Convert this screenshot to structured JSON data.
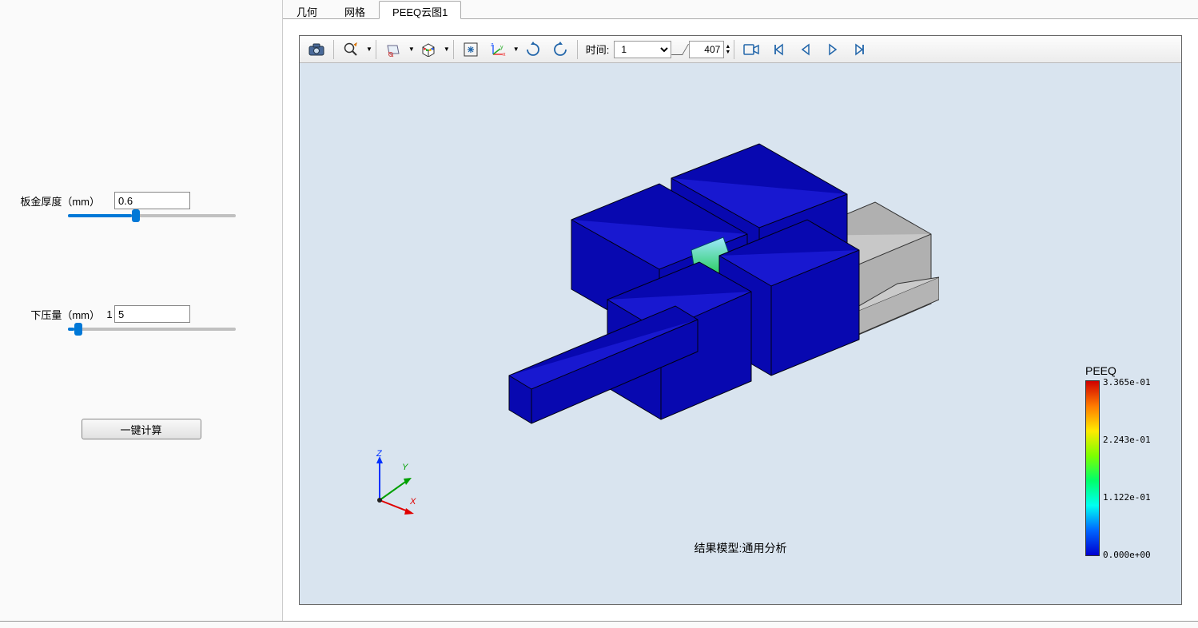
{
  "left": {
    "thickness_label": "板金厚度（mm）",
    "thickness_value": "0.6",
    "press_label": "下压量（mm）",
    "press_extra": "1",
    "press_value": "5",
    "compute_button": "一键计算"
  },
  "tabs": {
    "geometry": "几何",
    "mesh": "网格",
    "peeq": "PEEQ云图1"
  },
  "toolbar": {
    "time_label": "时间:",
    "time_select": "1",
    "time_value": "407"
  },
  "viewer": {
    "result_label": "结果模型:通用分析",
    "axis": {
      "x": "X",
      "y": "Y",
      "z": "Z",
      "origin": "o"
    }
  },
  "legend": {
    "title": "PEEQ",
    "ticks": [
      "3.365e-01",
      "2.243e-01",
      "1.122e-01",
      "0.000e+00"
    ]
  },
  "chart_data": {
    "type": "contour-legend",
    "variable": "PEEQ",
    "min": 0.0,
    "max": 0.3365,
    "ticks": [
      0.3365,
      0.2243,
      0.1122,
      0.0
    ],
    "colormap": [
      "#d00000",
      "#ff7b00",
      "#ffea00",
      "#7cff00",
      "#00ff6a",
      "#00fff2",
      "#0066ff",
      "#0000d0"
    ]
  }
}
